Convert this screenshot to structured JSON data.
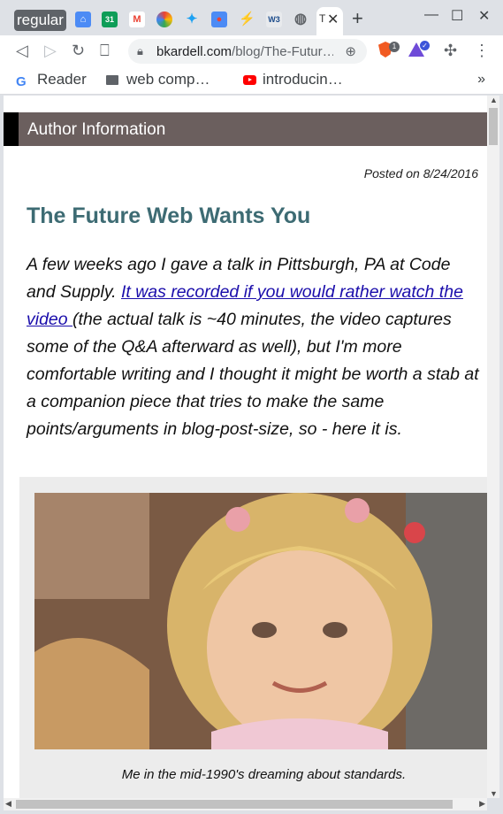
{
  "tabs": {
    "group_label": "regular",
    "active_tab_initial": "T",
    "favicons": [
      {
        "name": "home",
        "color": "#4c8bf5",
        "glyph": "⌂"
      },
      {
        "name": "calendar",
        "color": "#0f9d58",
        "glyph": "31"
      },
      {
        "name": "gmail",
        "color": "#ffffff",
        "glyph": "M"
      },
      {
        "name": "photos",
        "color": "#fbbc05",
        "glyph": "✿"
      },
      {
        "name": "twitter",
        "color": "#1da1f2",
        "glyph": "✦"
      },
      {
        "name": "record",
        "color": "#4c8bf5",
        "glyph": "●"
      },
      {
        "name": "slash",
        "color": "#1e88e5",
        "glyph": "⚡"
      },
      {
        "name": "w3c",
        "color": "#e0e0e0",
        "glyph": "W3"
      },
      {
        "name": "globe",
        "color": "#5f6368",
        "glyph": "◍"
      }
    ]
  },
  "address": {
    "domain": "bkardell.com",
    "path": "/blog/The-Futur…"
  },
  "extensions": {
    "brave_count": "1"
  },
  "bookmarks": [
    {
      "label": "Reader"
    },
    {
      "label": "web comp…"
    },
    {
      "label": "introducin…"
    }
  ],
  "page": {
    "author_bar": "Author Information",
    "posted": "Posted on 8/24/2016",
    "title": "The Future Web Wants You",
    "intro_before": "A few weeks ago I gave a talk in Pittsburgh, PA at Code and Supply. ",
    "intro_link": "It was recorded if you would rather watch the video ",
    "intro_after": "(the actual talk is ~40 minutes, the video captures some of the Q&A afterward as well), but I'm more comfortable writing and I thought it might be worth a stab at a companion piece that tries to make the same points/arguments in blog-post-size, so - here it is.",
    "caption": "Me in the mid-1990's dreaming about standards."
  }
}
